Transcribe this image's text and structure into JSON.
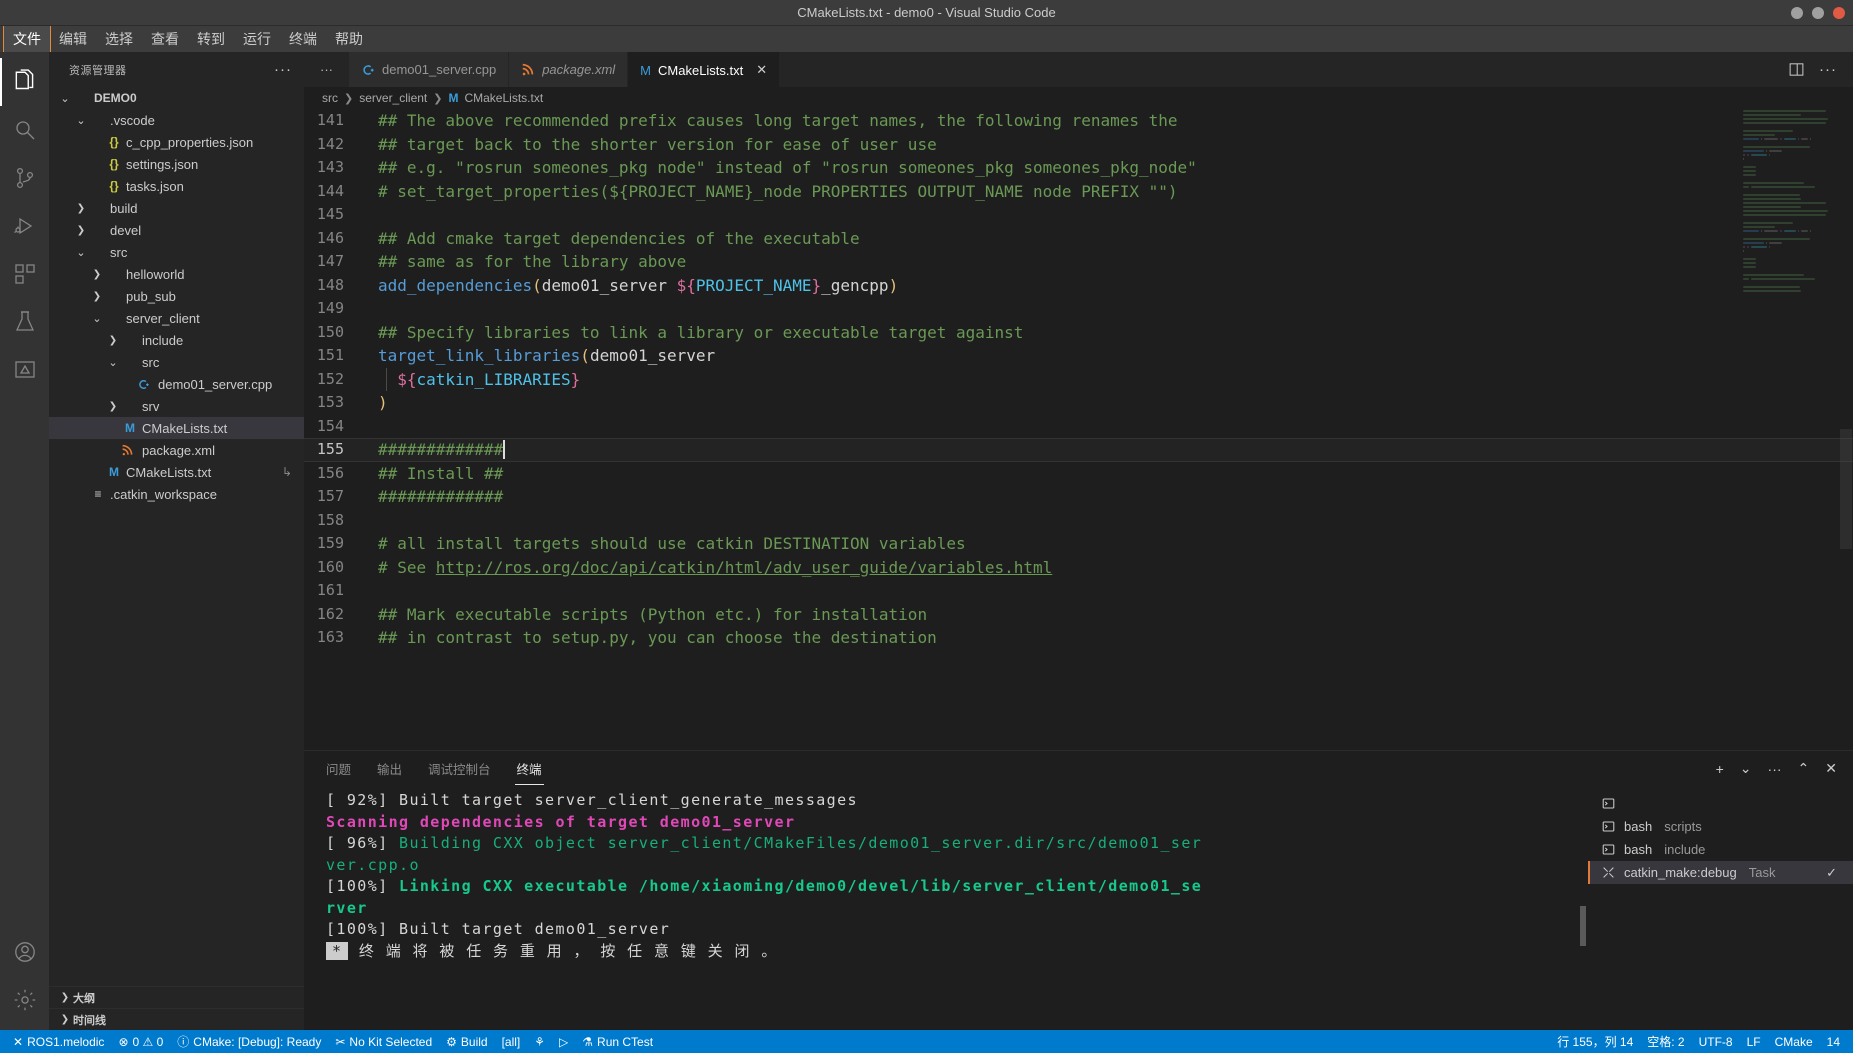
{
  "window": {
    "title": "CMakeLists.txt - demo0 - Visual Studio Code",
    "minimize_label": "minimize",
    "maximize_label": "maximize",
    "close_label": "close"
  },
  "menubar": {
    "items": [
      {
        "label": "文件",
        "focused": true
      },
      {
        "label": "编辑",
        "focused": false
      },
      {
        "label": "选择",
        "focused": false
      },
      {
        "label": "查看",
        "focused": false
      },
      {
        "label": "转到",
        "focused": false
      },
      {
        "label": "运行",
        "focused": false
      },
      {
        "label": "终端",
        "focused": false
      },
      {
        "label": "帮助",
        "focused": false
      }
    ]
  },
  "activitybar": {
    "items": [
      {
        "name": "explorer",
        "icon": "files-icon",
        "active": true
      },
      {
        "name": "search",
        "icon": "search-icon",
        "active": false
      },
      {
        "name": "source-control",
        "icon": "source-control-icon",
        "active": false
      },
      {
        "name": "run-debug",
        "icon": "run-debug-icon",
        "active": false
      },
      {
        "name": "extensions",
        "icon": "extensions-icon",
        "active": false
      },
      {
        "name": "testing",
        "icon": "beaker-icon",
        "active": false
      },
      {
        "name": "cmake",
        "icon": "cmake-icon",
        "active": false
      }
    ],
    "bottom": [
      {
        "name": "accounts",
        "icon": "account-icon"
      },
      {
        "name": "manage",
        "icon": "gear-icon"
      }
    ]
  },
  "sidebar": {
    "title": "资源管理器",
    "more_label": "···",
    "tree": [
      {
        "label": "DEMO0",
        "indent": 0,
        "twist": "chevron-down",
        "icon": "",
        "root": true,
        "selected": false
      },
      {
        "label": ".vscode",
        "indent": 1,
        "twist": "chevron-down",
        "icon": "",
        "root": false,
        "selected": false
      },
      {
        "label": "c_cpp_properties.json",
        "indent": 2,
        "twist": "",
        "icon": "{}",
        "icon_kind": "json",
        "root": false,
        "selected": false
      },
      {
        "label": "settings.json",
        "indent": 2,
        "twist": "",
        "icon": "{}",
        "icon_kind": "json",
        "root": false,
        "selected": false
      },
      {
        "label": "tasks.json",
        "indent": 2,
        "twist": "",
        "icon": "{}",
        "icon_kind": "json",
        "root": false,
        "selected": false
      },
      {
        "label": "build",
        "indent": 1,
        "twist": "chevron-right",
        "icon": "",
        "root": false,
        "selected": false
      },
      {
        "label": "devel",
        "indent": 1,
        "twist": "chevron-right",
        "icon": "",
        "root": false,
        "selected": false
      },
      {
        "label": "src",
        "indent": 1,
        "twist": "chevron-down",
        "icon": "",
        "root": false,
        "selected": false
      },
      {
        "label": "helloworld",
        "indent": 2,
        "twist": "chevron-right",
        "icon": "",
        "root": false,
        "selected": false
      },
      {
        "label": "pub_sub",
        "indent": 2,
        "twist": "chevron-right",
        "icon": "",
        "root": false,
        "selected": false
      },
      {
        "label": "server_client",
        "indent": 2,
        "twist": "chevron-down",
        "icon": "",
        "root": false,
        "selected": false
      },
      {
        "label": "include",
        "indent": 3,
        "twist": "chevron-right",
        "icon": "",
        "root": false,
        "selected": false
      },
      {
        "label": "src",
        "indent": 3,
        "twist": "chevron-down",
        "icon": "",
        "root": false,
        "selected": false
      },
      {
        "label": "demo01_server.cpp",
        "indent": 4,
        "twist": "",
        "icon": "C",
        "icon_kind": "cpp",
        "root": false,
        "selected": false
      },
      {
        "label": "srv",
        "indent": 3,
        "twist": "chevron-right",
        "icon": "",
        "root": false,
        "selected": false
      },
      {
        "label": "CMakeLists.txt",
        "indent": 3,
        "twist": "",
        "icon": "M",
        "icon_kind": "md",
        "root": false,
        "selected": true
      },
      {
        "label": "package.xml",
        "indent": 3,
        "twist": "",
        "icon": "xml",
        "icon_kind": "xml",
        "root": false,
        "selected": false
      },
      {
        "label": "CMakeLists.txt",
        "indent": 2,
        "twist": "",
        "icon": "M",
        "icon_kind": "md",
        "root": false,
        "selected": false,
        "trail": "↳"
      },
      {
        "label": ".catkin_workspace",
        "indent": 1,
        "twist": "",
        "icon": "≡",
        "icon_kind": "plain",
        "root": false,
        "selected": false
      }
    ],
    "sections": [
      {
        "label": "大纲",
        "twist": "chevron-right"
      },
      {
        "label": "时间线",
        "twist": "chevron-right"
      }
    ]
  },
  "editor": {
    "tabs": [
      {
        "label": "demo01_server.cpp",
        "icon": "cpp-file-icon",
        "icon_kind": "cpp",
        "active": false,
        "preview": false,
        "closable": false
      },
      {
        "label": "package.xml",
        "icon": "xml-file-icon",
        "icon_kind": "xml",
        "active": false,
        "preview": true,
        "closable": false
      },
      {
        "label": "CMakeLists.txt",
        "icon": "md-file-icon",
        "icon_kind": "md",
        "active": true,
        "preview": false,
        "closable": true,
        "close_label": "✕"
      }
    ],
    "tab_overflow_label": "···",
    "actions": {
      "split_label": "split-editor",
      "more_label": "···"
    },
    "breadcrumb": [
      {
        "label": "src",
        "icon": ""
      },
      {
        "label": "server_client",
        "icon": ""
      },
      {
        "label": "CMakeLists.txt",
        "icon": "M"
      }
    ],
    "first_line_number": 141,
    "active_line": 155,
    "lines": [
      {
        "n": 141,
        "tokens": [
          {
            "t": "## The above recommended prefix causes long target names, the following renames the",
            "c": "cm"
          }
        ]
      },
      {
        "n": 142,
        "tokens": [
          {
            "t": "## target back to the shorter version for ease of user use",
            "c": "cm"
          }
        ]
      },
      {
        "n": 143,
        "tokens": [
          {
            "t": "## e.g. \"rosrun someones_pkg node\" instead of \"rosrun someones_pkg someones_pkg_node\"",
            "c": "cm"
          }
        ]
      },
      {
        "n": 144,
        "tokens": [
          {
            "t": "# set_target_properties(${PROJECT_NAME}_node PROPERTIES OUTPUT_NAME node PREFIX \"\")",
            "c": "cm"
          }
        ]
      },
      {
        "n": 145,
        "tokens": []
      },
      {
        "n": 146,
        "tokens": [
          {
            "t": "## Add cmake target dependencies of the executable",
            "c": "cm"
          }
        ]
      },
      {
        "n": 147,
        "tokens": [
          {
            "t": "## same as for the library above",
            "c": "cm"
          }
        ]
      },
      {
        "n": 148,
        "tokens": [
          {
            "t": "add_dependencies",
            "c": "fn"
          },
          {
            "t": "(",
            "c": "pa"
          },
          {
            "t": "demo01_server ",
            "c": "pl"
          },
          {
            "t": "${",
            "c": "pk"
          },
          {
            "t": "PROJECT_NAME",
            "c": "va"
          },
          {
            "t": "}",
            "c": "pk"
          },
          {
            "t": "_gencpp",
            "c": "pl"
          },
          {
            "t": ")",
            "c": "pa"
          }
        ]
      },
      {
        "n": 149,
        "tokens": []
      },
      {
        "n": 150,
        "tokens": [
          {
            "t": "## Specify libraries to link a library or executable target against",
            "c": "cm"
          }
        ]
      },
      {
        "n": 151,
        "tokens": [
          {
            "t": "target_link_libraries",
            "c": "fn"
          },
          {
            "t": "(",
            "c": "pa"
          },
          {
            "t": "demo01_server",
            "c": "pl"
          }
        ]
      },
      {
        "n": 152,
        "tokens": [
          {
            "t": "  ",
            "c": "pl"
          },
          {
            "t": "${",
            "c": "pk"
          },
          {
            "t": "catkin_LIBRARIES",
            "c": "va"
          },
          {
            "t": "}",
            "c": "pk"
          }
        ]
      },
      {
        "n": 153,
        "tokens": [
          {
            "t": ")",
            "c": "pa"
          }
        ]
      },
      {
        "n": 154,
        "tokens": []
      },
      {
        "n": 155,
        "tokens": [
          {
            "t": "#############",
            "c": "cm"
          }
        ],
        "caret_after": true
      },
      {
        "n": 156,
        "tokens": [
          {
            "t": "## Install ##",
            "c": "cm"
          }
        ]
      },
      {
        "n": 157,
        "tokens": [
          {
            "t": "#############",
            "c": "cm"
          }
        ]
      },
      {
        "n": 158,
        "tokens": []
      },
      {
        "n": 159,
        "tokens": [
          {
            "t": "# all install targets should use catkin DESTINATION variables",
            "c": "cm"
          }
        ]
      },
      {
        "n": 160,
        "tokens": [
          {
            "t": "# See ",
            "c": "cm"
          },
          {
            "t": "http://ros.org/doc/api/catkin/html/adv_user_guide/variables.html",
            "c": "lnk"
          }
        ]
      },
      {
        "n": 161,
        "tokens": []
      },
      {
        "n": 162,
        "tokens": [
          {
            "t": "## Mark executable scripts (Python etc.) for installation",
            "c": "cm"
          }
        ]
      },
      {
        "n": 163,
        "tokens": [
          {
            "t": "## in contrast to setup.py, you can choose the destination",
            "c": "cm"
          }
        ]
      }
    ]
  },
  "panel": {
    "tabs": [
      {
        "label": "问题",
        "active": false
      },
      {
        "label": "输出",
        "active": false
      },
      {
        "label": "调试控制台",
        "active": false
      },
      {
        "label": "终端",
        "active": true
      }
    ],
    "actions": [
      {
        "name": "new-terminal",
        "glyph": "+"
      },
      {
        "name": "terminal-dropdown",
        "glyph": "⌄"
      },
      {
        "name": "panel-more",
        "glyph": "···"
      },
      {
        "name": "maximize-panel",
        "glyph": "⌃"
      },
      {
        "name": "close-panel",
        "glyph": "✕"
      }
    ],
    "terminal_lines": [
      {
        "segments": [
          {
            "t": "[ 92%] Built target server_client_generate_messages",
            "c": "t-white"
          }
        ]
      },
      {
        "segments": [
          {
            "t": "Scanning dependencies of target demo01_server",
            "c": "t-magenta"
          }
        ]
      },
      {
        "segments": [
          {
            "t": "[ 96%] ",
            "c": "t-white"
          },
          {
            "t": "Building CXX object server_client/CMakeFiles/demo01_server.dir/src/demo01_ser",
            "c": "t-green"
          }
        ]
      },
      {
        "segments": [
          {
            "t": "ver.cpp.o",
            "c": "t-green"
          }
        ]
      },
      {
        "segments": [
          {
            "t": "[100%] ",
            "c": "t-white"
          },
          {
            "t": "Linking CXX executable /home/xiaoming/demo0/devel/lib/server_client/demo01_se",
            "c": "t-greenb"
          }
        ]
      },
      {
        "segments": [
          {
            "t": "rver",
            "c": "t-greenb"
          }
        ]
      },
      {
        "segments": [
          {
            "t": "[100%] Built target demo01_server",
            "c": "t-white"
          }
        ]
      }
    ],
    "terminal_prompt": {
      "marker": "*",
      "text": "终 端 将 被 任 务 重 用 ， 按 任 意 键 关 闭 。"
    },
    "terminal_list": [
      {
        "label": "",
        "sub": "",
        "icon": "terminal-icon",
        "active": false,
        "check": ""
      },
      {
        "label": "bash",
        "sub": "scripts",
        "icon": "terminal-icon",
        "active": false,
        "check": ""
      },
      {
        "label": "bash",
        "sub": "include",
        "icon": "terminal-icon",
        "active": false,
        "check": ""
      },
      {
        "label": "catkin_make:debug",
        "sub": "Task",
        "icon": "tools-icon",
        "active": true,
        "check": "✓"
      }
    ]
  },
  "statusbar": {
    "left": [
      {
        "name": "remote-indicator",
        "glyph": "✕",
        "label": "ROS1.melodic"
      },
      {
        "name": "problems",
        "glyph": "⊗",
        "label": "0  ⚠ 0"
      },
      {
        "name": "cmake-status",
        "glyph": "ⓘ",
        "label": "CMake: [Debug]: Ready"
      },
      {
        "name": "kit-selector",
        "glyph": "✂",
        "label": "No Kit Selected"
      },
      {
        "name": "build-button",
        "glyph": "⚙",
        "label": "Build"
      },
      {
        "name": "build-target",
        "glyph": "",
        "label": "[all]"
      },
      {
        "name": "debug-button",
        "glyph": "⚘",
        "label": ""
      },
      {
        "name": "launch-button",
        "glyph": "▷",
        "label": ""
      },
      {
        "name": "ctest-button",
        "glyph": "⚗",
        "label": "Run CTest"
      }
    ],
    "right": [
      {
        "name": "cursor-position",
        "label": "行 155，列 14"
      },
      {
        "name": "indentation",
        "label": "空格: 2"
      },
      {
        "name": "encoding",
        "label": "UTF-8"
      },
      {
        "name": "eol",
        "label": "LF"
      },
      {
        "name": "language-mode",
        "label": "CMake"
      },
      {
        "name": "notifications",
        "label": "14"
      }
    ]
  },
  "colors": {
    "accent": "#007acc",
    "focus_border": "#e08a3c",
    "comment_green": "#6a9955",
    "function_blue": "#569cd6",
    "terminal_magenta": "#e048b8",
    "terminal_green": "#16b07a"
  }
}
